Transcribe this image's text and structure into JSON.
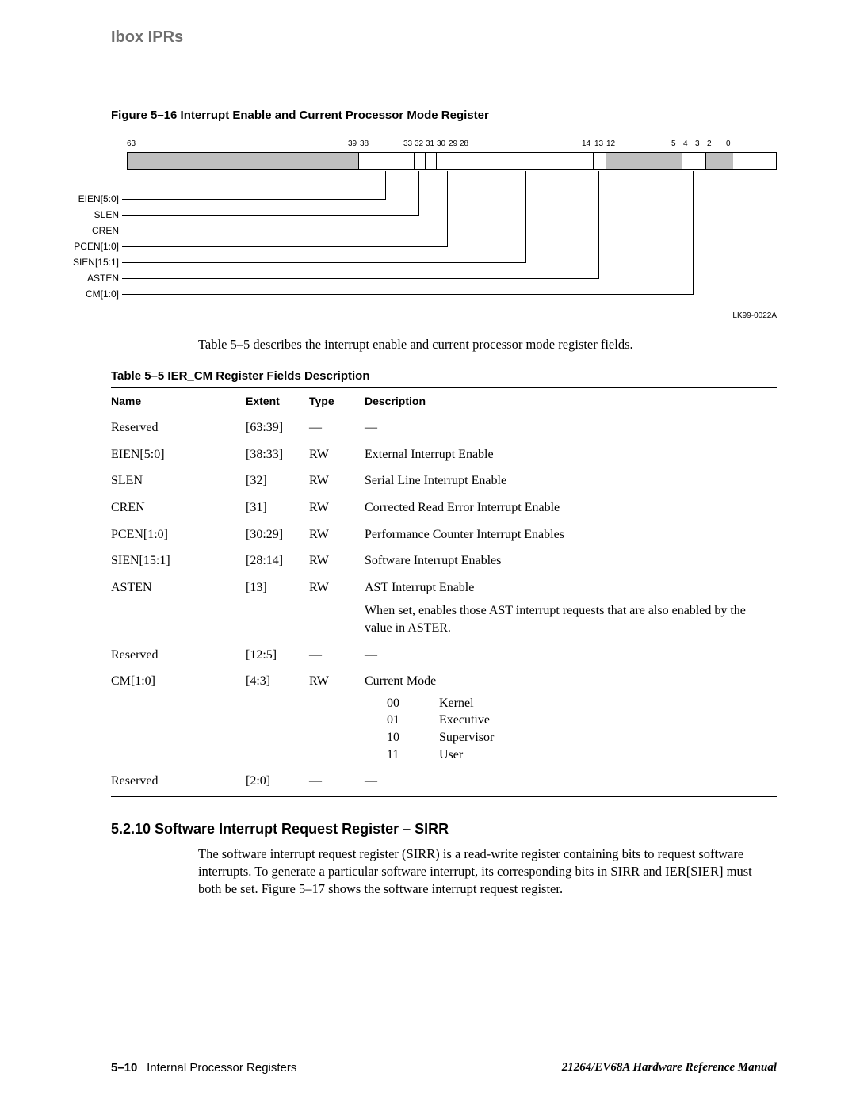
{
  "header": "Ibox IPRs",
  "figure": {
    "caption": "Figure 5–16  Interrupt Enable and Current Processor Mode Register",
    "bit_labels": [
      "63",
      "39",
      "38",
      "33",
      "32",
      "31",
      "30",
      "29",
      "28",
      "14",
      "13",
      "12",
      "5",
      "4",
      "3",
      "2",
      "0"
    ],
    "signals": [
      "EIEN[5:0]",
      "SLEN",
      "CREN",
      "PCEN[1:0]",
      "SIEN[15:1]",
      "ASTEN",
      "CM[1:0]"
    ],
    "tag": "LK99-0022A"
  },
  "para1": "Table 5–5 describes the interrupt enable and current processor mode register fields.",
  "table": {
    "caption": "Table 5–5  IER_CM Register Fields Description",
    "headers": [
      "Name",
      "Extent",
      "Type",
      "Description"
    ],
    "rows": [
      {
        "name": "Reserved",
        "extent": "[63:39]",
        "type": "—",
        "desc": "—"
      },
      {
        "name": "EIEN[5:0]",
        "extent": "[38:33]",
        "type": "RW",
        "desc": "External Interrupt Enable"
      },
      {
        "name": "SLEN",
        "extent": "[32]",
        "type": "RW",
        "desc": "Serial Line Interrupt Enable"
      },
      {
        "name": "CREN",
        "extent": "[31]",
        "type": "RW",
        "desc": "Corrected Read Error Interrupt Enable"
      },
      {
        "name": "PCEN[1:0]",
        "extent": "[30:29]",
        "type": "RW",
        "desc": "Performance Counter Interrupt Enables"
      },
      {
        "name": "SIEN[15:1]",
        "extent": "[28:14]",
        "type": "RW",
        "desc": "Software Interrupt Enables"
      },
      {
        "name": "ASTEN",
        "extent": "[13]",
        "type": "RW",
        "desc": "AST Interrupt Enable",
        "extra": "When set, enables those AST interrupt requests that are also enabled by the value in ASTER."
      },
      {
        "name": "Reserved",
        "extent": "[12:5]",
        "type": "—",
        "desc": "—"
      },
      {
        "name": "CM[1:0]",
        "extent": "[4:3]",
        "type": "RW",
        "desc": "Current Mode",
        "modes": [
          {
            "code": "00",
            "label": "Kernel"
          },
          {
            "code": "01",
            "label": "Executive"
          },
          {
            "code": "10",
            "label": "Supervisor"
          },
          {
            "code": "11",
            "label": "User"
          }
        ]
      },
      {
        "name": "Reserved",
        "extent": "[2:0]",
        "type": "—",
        "desc": "—"
      }
    ]
  },
  "section": {
    "heading": "5.2.10 Software Interrupt Request Register – SIRR",
    "body": "The software interrupt request register (SIRR) is a read-write register containing bits to request software interrupts. To generate a particular software interrupt, its corresponding bits in SIRR and IER[SIER] must both be set. Figure 5–17 shows the software interrupt request register."
  },
  "footer": {
    "page": "5–10",
    "section": "Internal Processor Registers",
    "book": "21264/EV68A Hardware Reference Manual"
  }
}
